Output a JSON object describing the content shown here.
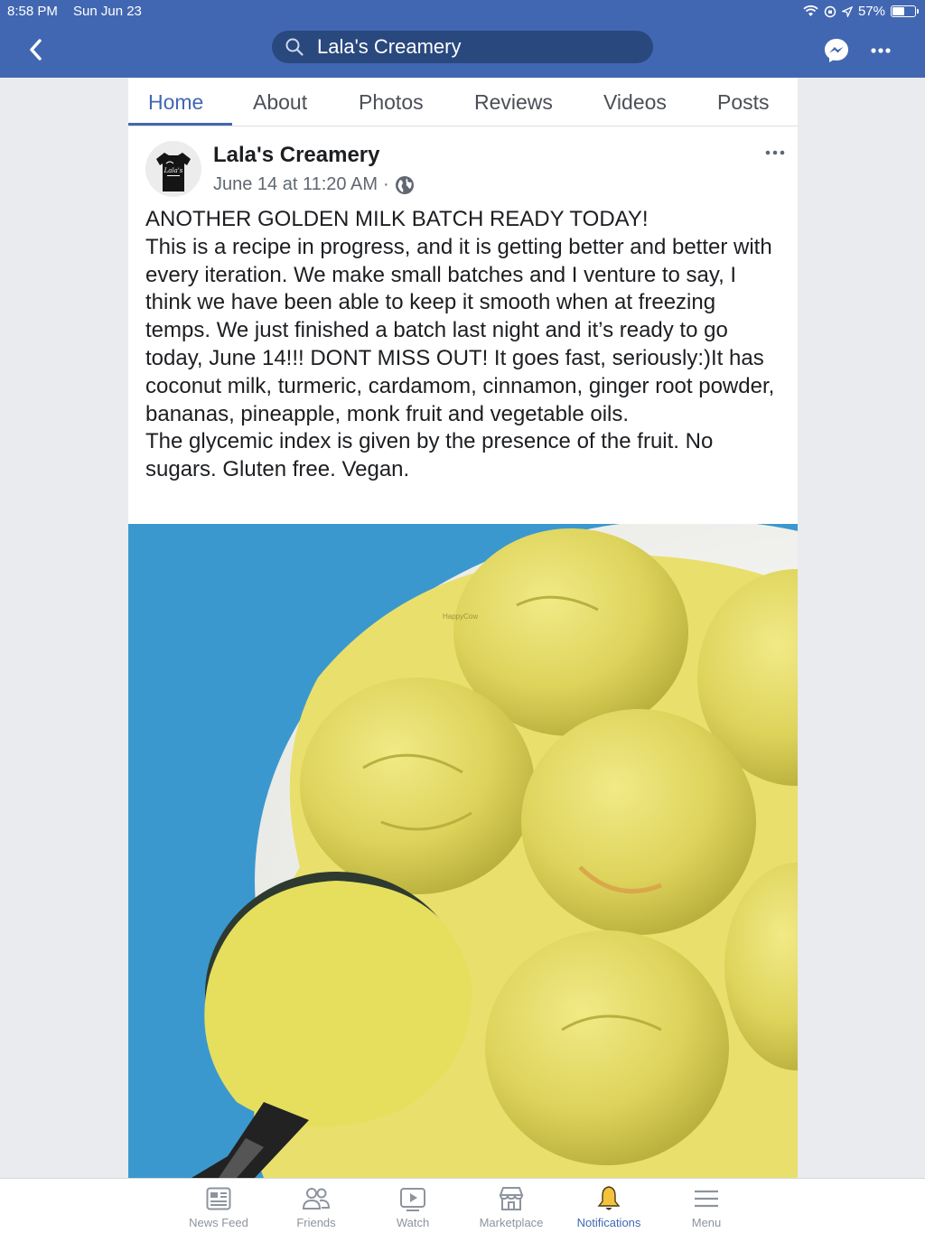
{
  "status_bar": {
    "time": "8:58 PM",
    "date": "Sun Jun 23",
    "battery_text": "57%",
    "battery_level": 0.57
  },
  "header": {
    "search_value": "Lala's Creamery",
    "back_icon": "back-chevron-icon",
    "messenger_icon": "messenger-icon",
    "more_icon": "more-dots-icon"
  },
  "tabs": [
    {
      "label": "Home",
      "active": true
    },
    {
      "label": "About"
    },
    {
      "label": "Photos"
    },
    {
      "label": "Reviews"
    },
    {
      "label": "Videos"
    },
    {
      "label": "Posts"
    }
  ],
  "post": {
    "page_name": "Lala's Creamery",
    "timestamp": "June 14 at 11:20 AM",
    "separator": "·",
    "privacy_icon": "globe-icon",
    "avatar_logo_text": "Lala's",
    "paragraphs": [
      "ANOTHER GOLDEN MILK BATCH READY TODAY!",
      "This is a recipe in progress, and it is getting better and better with every iteration. We make small batches and I venture to say, I think we have been able to keep it smooth when at freezing temps. We just finished a batch last night and it’s ready to go today, June 14!!! DONT MISS OUT! It goes fast, seriously:)It has coconut milk, turmeric, cardamom, cinnamon, ginger root powder, bananas, pineapple, monk fruit and vegetable oils.",
      "The glycemic index is given by the presence of the fruit. No sugars. Gluten free. Vegan."
    ],
    "photo_watermark": "HappyCow"
  },
  "bottom_nav": [
    {
      "label": "News Feed",
      "icon": "news-feed-icon"
    },
    {
      "label": "Friends",
      "icon": "friends-icon"
    },
    {
      "label": "Watch",
      "icon": "watch-icon"
    },
    {
      "label": "Marketplace",
      "icon": "marketplace-icon"
    },
    {
      "label": "Notifications",
      "icon": "bell-icon",
      "active": true
    },
    {
      "label": "Menu",
      "icon": "menu-icon"
    }
  ],
  "colors": {
    "brand": "#4267b2",
    "search_bg": "#29487d",
    "background": "#e9ebee",
    "ice_cream": "#e8e06a",
    "plate_bg": "#3d9bd1"
  }
}
